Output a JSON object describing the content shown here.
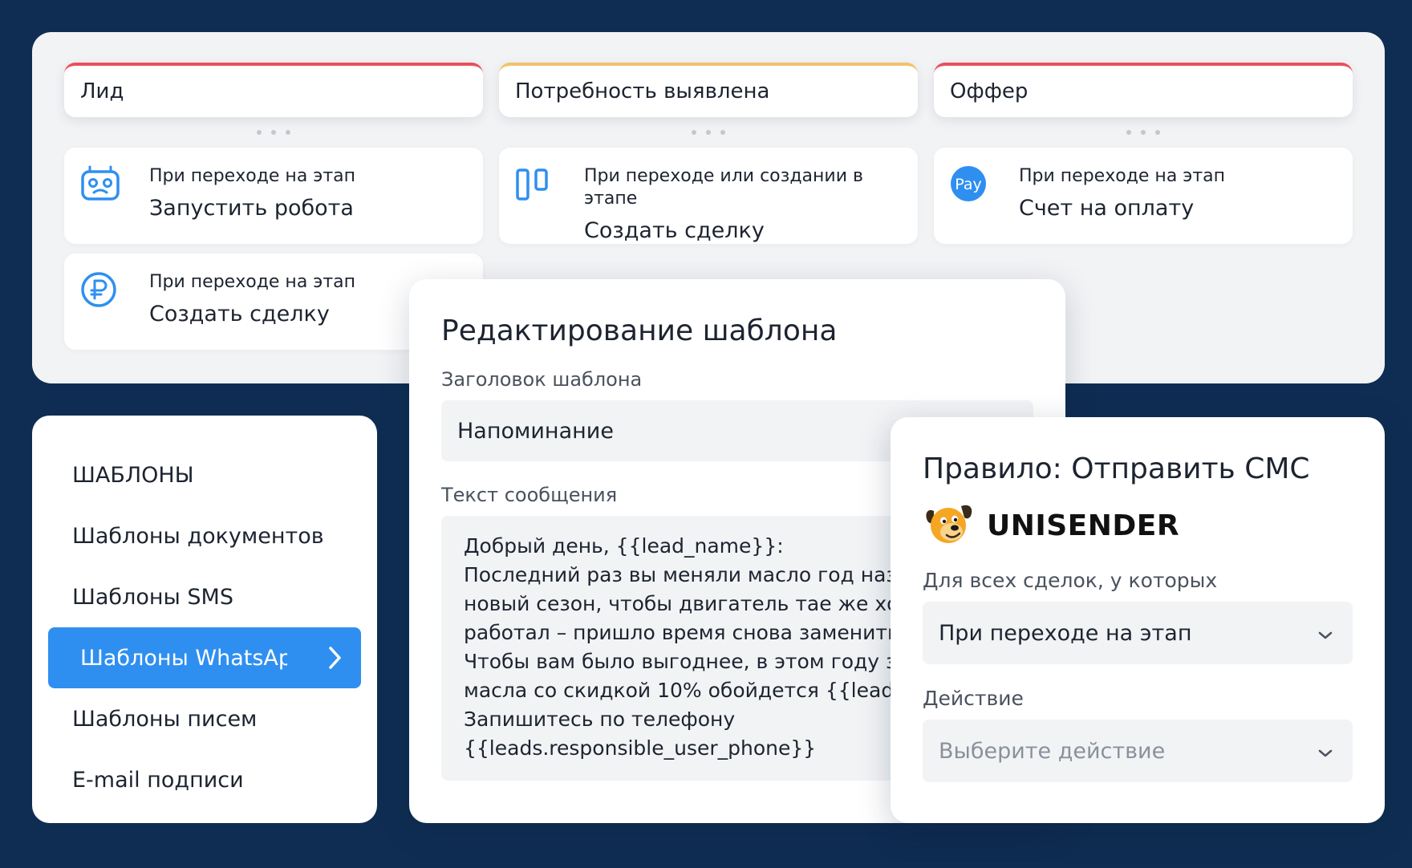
{
  "pipeline": {
    "stages": [
      {
        "title": "Лид",
        "accent": "#e8505b"
      },
      {
        "title": "Потребность выявлена",
        "accent": "#f2c26b"
      },
      {
        "title": "Оффер",
        "accent": "#e8505b"
      }
    ],
    "triggers": [
      {
        "icon": "robot-icon",
        "sub": "При переходе на этап",
        "main": "Запустить робота"
      },
      {
        "icon": "pipeline-columns-icon",
        "sub": "При переходе или создании в этапе",
        "main": "Создать сделку"
      },
      {
        "icon": "pay-icon",
        "icon_text": "Pay",
        "sub": "При переходе на этап",
        "main": "Счет на оплату"
      },
      {
        "icon": "ruble-icon",
        "sub": "При переходе на этап",
        "main": "Создать сделку"
      }
    ]
  },
  "templates_menu": {
    "items": [
      {
        "label": "ШАБЛОНЫ"
      },
      {
        "label": "Шаблоны документов"
      },
      {
        "label": "Шаблоны SMS"
      },
      {
        "label": "Шаблоны WhatsApp",
        "active": true
      },
      {
        "label": "Шаблоны писем"
      },
      {
        "label": "E-mail подписи"
      }
    ]
  },
  "editor": {
    "title": "Редактирование шаблона",
    "header_label": "Заголовок шаблона",
    "header_value": "Напоминание",
    "message_label": "Текст сообщения",
    "message_text": "Добрый день, {{lead_name}}:\nПоследний раз вы меняли масло год назад. В\nновый сезон, чтобы двигатель тае же хорошо\nработал – пришло время снова заменить масло.\nЧтобы вам было выгоднее, в этом году замена\nмасла со скидкой 10% обойдется {{lead.price}}\nЗапишитесь по телефону\n{{leads.responsible_user_phone}}"
  },
  "rule": {
    "title": "Правило: Отправить СМС",
    "brand_name": "UNISENDER",
    "condition_label": "Для всех сделок, у которых",
    "condition_value": "При переходе на этап",
    "action_label": "Действие",
    "action_placeholder": "Выберите действие"
  },
  "colors": {
    "background": "#0f2d52",
    "accent_blue": "#2f8ff0",
    "stage_red": "#e8505b",
    "stage_yellow": "#f2c26b"
  }
}
